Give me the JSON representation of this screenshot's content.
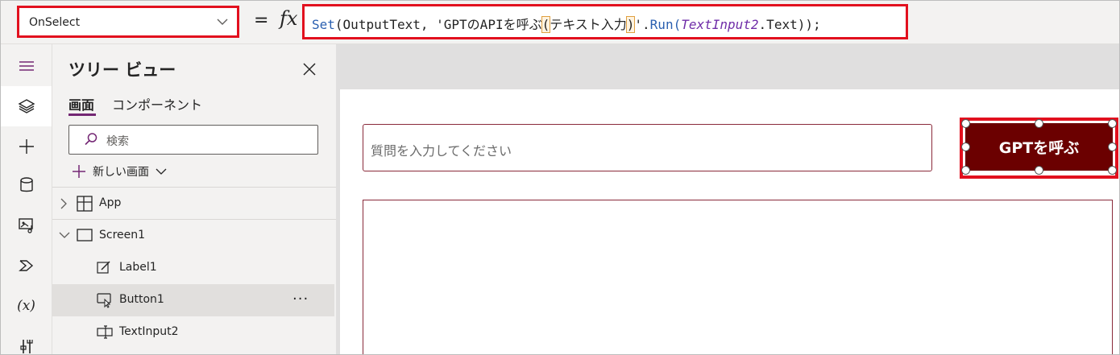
{
  "formula_bar": {
    "property": "OnSelect",
    "equals": "=",
    "fx": "fx",
    "formula": {
      "set_fn": "Set",
      "open": "(",
      "var": "OutputText",
      "sep": ", '",
      "string_a": "GPTのAPIを呼ぶ",
      "string_b": "(",
      "string_c": "テキスト入力",
      "string_d": ")",
      "string_e": "'.",
      "run_fn": "Run",
      "open2": "(",
      "control": "TextInput2",
      "prop": ".Text",
      "close": "));"
    }
  },
  "rail": {
    "items": [
      "menu-icon",
      "layers-icon",
      "plus-icon",
      "database-icon",
      "media-icon",
      "power-automate-icon",
      "variables-icon",
      "tools-icon"
    ],
    "variables_glyph": "(x)"
  },
  "tree": {
    "title": "ツリー ビュー",
    "tabs": {
      "screen": "画面",
      "components": "コンポーネント"
    },
    "search_placeholder": "検索",
    "new_screen": "新しい画面",
    "rows": {
      "app": "App",
      "screen1": "Screen1",
      "label1": "Label1",
      "button1": "Button1",
      "textinput2": "TextInput2",
      "more": "···"
    }
  },
  "canvas": {
    "input_placeholder": "質問を入力してください",
    "button_label": "GPTを呼ぶ"
  },
  "colors": {
    "accent": "#742774",
    "highlight_red": "#e2101e",
    "button_bg": "#6b0000",
    "border_maroon": "#8a2a3a"
  }
}
